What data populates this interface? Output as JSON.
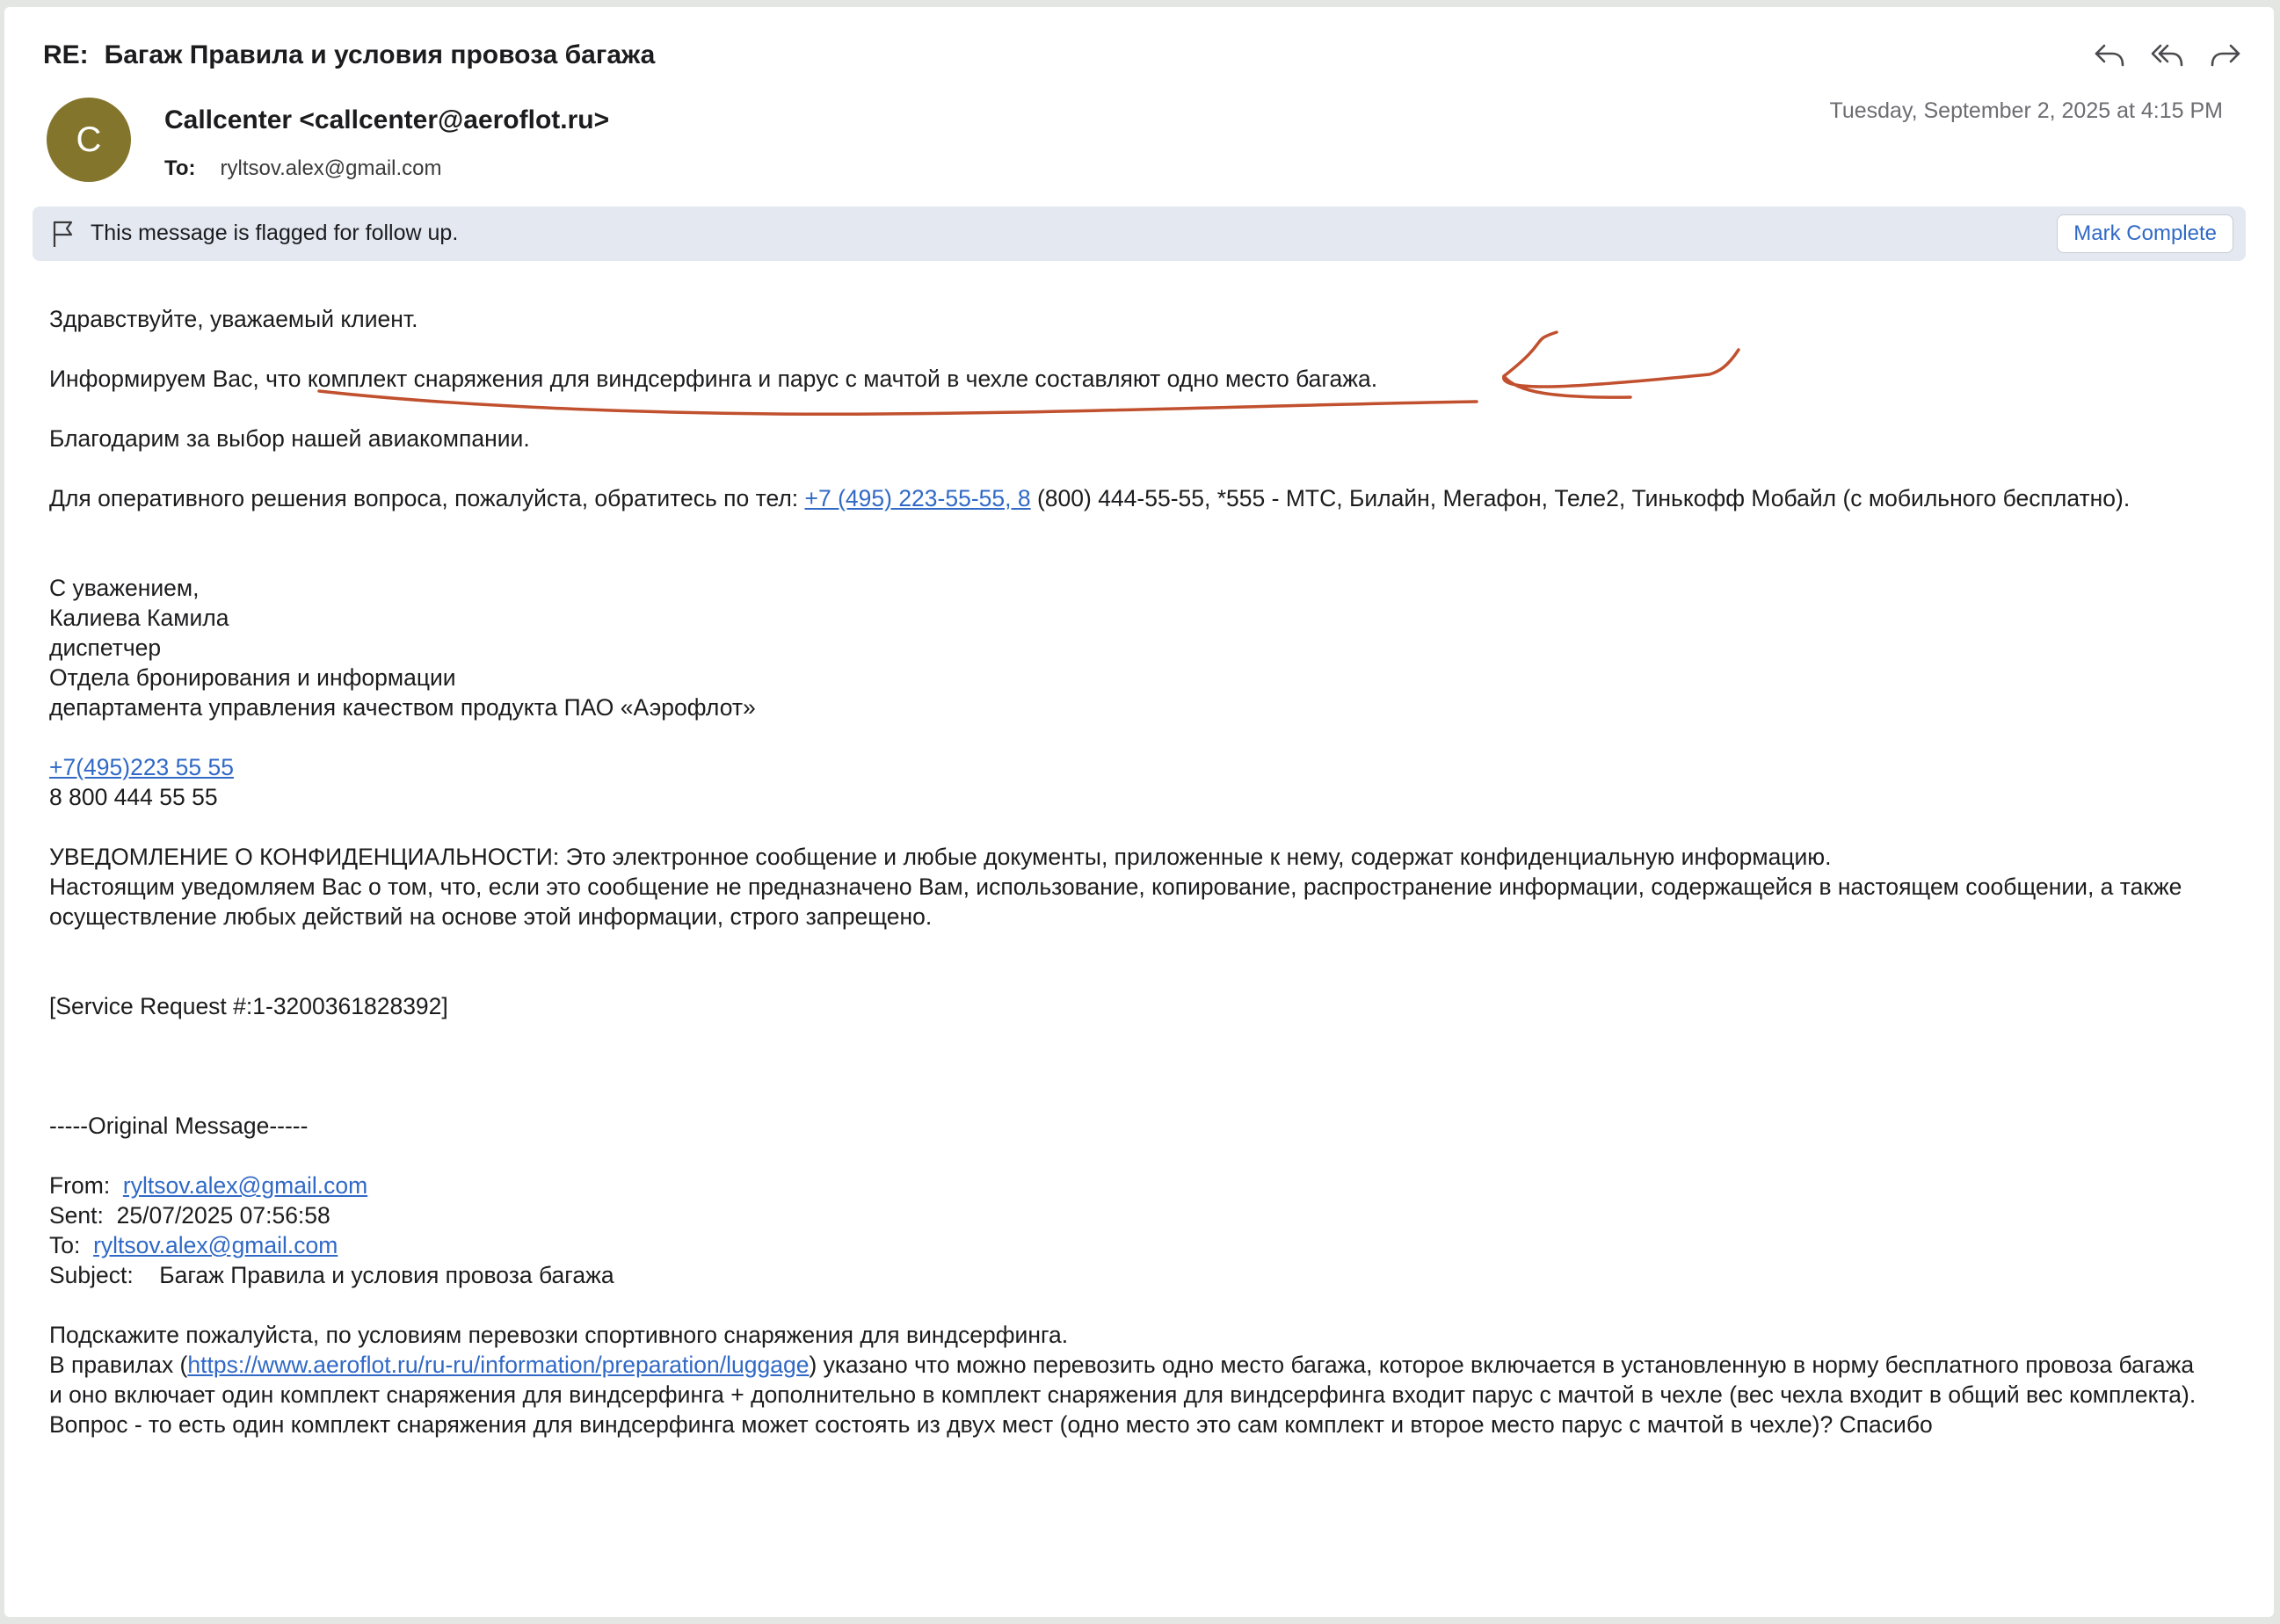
{
  "header": {
    "subject_prefix": "RE:",
    "subject": "Багаж Правила и условия провоза багажа",
    "sender": "Callcenter <callcenter@aeroflot.ru>",
    "avatar_letter": "C",
    "to_label": "To:",
    "to_value": "ryltsov.alex@gmail.com",
    "date": "Tuesday, September 2, 2025 at 4:15 PM",
    "actions": [
      "reply-icon",
      "reply-all-icon",
      "forward-icon"
    ]
  },
  "flag": {
    "text": "This message is flagged for follow up.",
    "button": "Mark Complete"
  },
  "body": {
    "greeting": "Здравствуйте, уважаемый клиент.",
    "info": "Информируем Вас, что комплект снаряжения для виндсерфинга и парус с мачтой в чехле составляют одно место багажа.",
    "thanks": "Благодарим за выбор нашей авиакомпании.",
    "contact_before": "Для оперативного решения вопроса, пожалуйста, обратитесь по тел: ",
    "contact_link": "+7 (495) 223-55-55, 8",
    "contact_after": " (800) 444-55-55, *555 - МТС, Билайн, Мегафон, Теле2, Тинькофф Мобайл (с мобильного бесплатно).",
    "signature": [
      "С уважением,",
      "Калиева Камила",
      "диспетчер",
      "Отдела бронирования и информации",
      "департамента управления качеством продукта ПАО «Аэрофлот»"
    ],
    "phone_link": "+7(495)223 55 55",
    "phone2": "8 800 444 55 55",
    "confidential_1": "УВЕДОМЛЕНИЕ О КОНФИДЕНЦИАЛЬНОСТИ: Это электронное сообщение и любые документы, приложенные к нему, содержат конфиденциальную информацию.",
    "confidential_2": "Настоящим уведомляем Вас о том, что, если это сообщение не предназначено Вам, использование, копирование, распространение информации, содержащейся в настоящем сообщении, а также осуществление любых действий на основе этой информации, строго запрещено.",
    "service_request": "[Service Request #:1-3200361828392]",
    "original_header": "-----Original Message-----",
    "from_label": "From:",
    "from_value": "ryltsov.alex@gmail.com",
    "sent_label": "Sent:",
    "sent_value": "25/07/2025 07:56:58",
    "to_label": "To:",
    "to_value": "ryltsov.alex@gmail.com",
    "subject_label": "Subject:",
    "subject_value": "Багаж Правила и условия провоза багажа",
    "question_1": "Подскажите пожалуйста, по условиям перевозки спортивного снаряжения для виндсерфинга.",
    "question_2_before": "В правилах (",
    "question_link": "https://www.aeroflot.ru/ru-ru/information/preparation/luggage",
    "question_2_after": ") указано что можно перевозить одно место багажа, которое включается в установленную в норму бесплатного провоза багажа и оно включает один комплект снаряжения для виндсерфинга + дополнительно в комплект снаряжения для виндсерфинга входит парус с мачтой в чехле (вес чехла входит в общий вес комплекта). Вопрос - то есть один комплект снаряжения для виндсерфинга может состоять из двух мест (одно место это сам комплект и второе место парус с мачтой в чехле)? Спасибо"
  },
  "colors": {
    "accent_link": "#3069c6",
    "avatar": "#84752c",
    "flag_banner": "#e3e8f1",
    "annotation": "#c1502e"
  }
}
